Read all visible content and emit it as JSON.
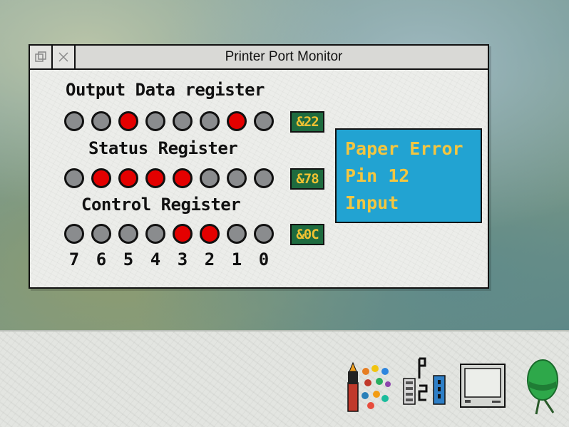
{
  "window": {
    "title": "Printer Port Monitor",
    "back_icon": "back-icon",
    "close_icon": "close-icon"
  },
  "registers": [
    {
      "label": "Output Data register",
      "bits": [
        0,
        0,
        1,
        0,
        0,
        0,
        1,
        0
      ],
      "hex": "&22"
    },
    {
      "label": "Status Register",
      "bits": [
        0,
        1,
        1,
        1,
        1,
        0,
        0,
        0
      ],
      "hex": "&78"
    },
    {
      "label": "Control Register",
      "bits": [
        0,
        0,
        0,
        0,
        1,
        1,
        0,
        0
      ],
      "hex": "&0C"
    }
  ],
  "bit_numbers": [
    "7",
    "6",
    "5",
    "4",
    "3",
    "2",
    "1",
    "0"
  ],
  "info": {
    "line1": "Paper Error",
    "line2": "Pin 12",
    "line3": "Input"
  },
  "colors": {
    "led_on": "#e40000",
    "led_off": "#8a8c8e",
    "hex_bg": "#1e6b3f",
    "hex_text": "#f1c232",
    "info_bg": "#22a3d2",
    "info_text": "#f3c640"
  },
  "iconbar": {
    "icons": [
      "paint-palette-icon",
      "printer-driver-icon",
      "display-monitor-icon",
      "acorn-icon"
    ]
  }
}
